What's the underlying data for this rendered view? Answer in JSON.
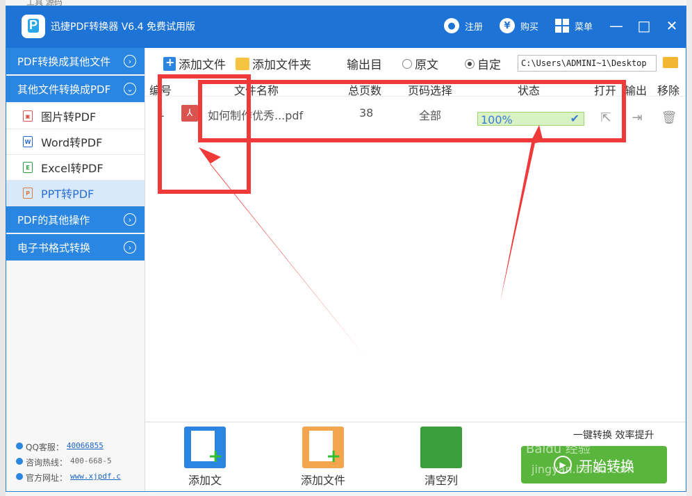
{
  "app": {
    "title": "迅捷PDF转换器 V6.4 免费试用版",
    "register_label": "注册",
    "buy_label": "购买",
    "menu_label": "菜单",
    "minimize": "—",
    "maximize": "□",
    "close": "✕"
  },
  "background": {
    "top_text": "工具 源码"
  },
  "sidebar": {
    "headings": [
      {
        "label": "PDF转换成其他文件",
        "chevron": "›"
      },
      {
        "label": "其他文件转换成PDF",
        "chevron": "⌄"
      },
      {
        "label": "PDF的其他操作",
        "chevron": "›"
      },
      {
        "label": "电子书格式转换",
        "chevron": "›"
      }
    ],
    "items": [
      {
        "label": "图片转PDF",
        "icon": "image-icon"
      },
      {
        "label": "Word转PDF",
        "icon": "word-icon"
      },
      {
        "label": "Excel转PDF",
        "icon": "excel-icon"
      },
      {
        "label": "PPT转PDF",
        "icon": "ppt-icon",
        "active": true
      }
    ],
    "contact": {
      "qq_label": "QQ客服：",
      "qq_value": "40066855",
      "hotline_label": "咨询热线：",
      "hotline_value": "400-668-5",
      "site_label": "官方网址：",
      "site_value": "www.xjpdf.c"
    }
  },
  "toolbar": {
    "add_file": "添加文件",
    "add_folder": "添加文件夹",
    "output_label": "输出目",
    "radio_original": "原文",
    "radio_custom": "自定",
    "output_path": "C:\\Users\\ADMINI~1\\Desktop"
  },
  "table": {
    "columns": [
      "编号",
      "文件名称",
      "总页数",
      "页码选择",
      "状态",
      "打开",
      "输出",
      "移除"
    ],
    "rows": [
      {
        "index": "1",
        "file_name": "如何制作优秀...pdf",
        "pages": "38",
        "page_select": "全部",
        "status": "100%",
        "progress": 1.0
      }
    ]
  },
  "bottom": {
    "add_file": "添加文",
    "add_folder": "添加文件",
    "clear_list": "清空列",
    "slogan": "一键转换 效率提升",
    "start": "开始转换"
  },
  "watermark": {
    "line1": "Baidu 经验",
    "line2": "jingyan.baidu.com"
  },
  "colors": {
    "brand_blue": "#1e73d6",
    "sidebar_blue": "#2a86e0",
    "start_green": "#5ab53d",
    "annotation_red": "#f03a3a"
  }
}
